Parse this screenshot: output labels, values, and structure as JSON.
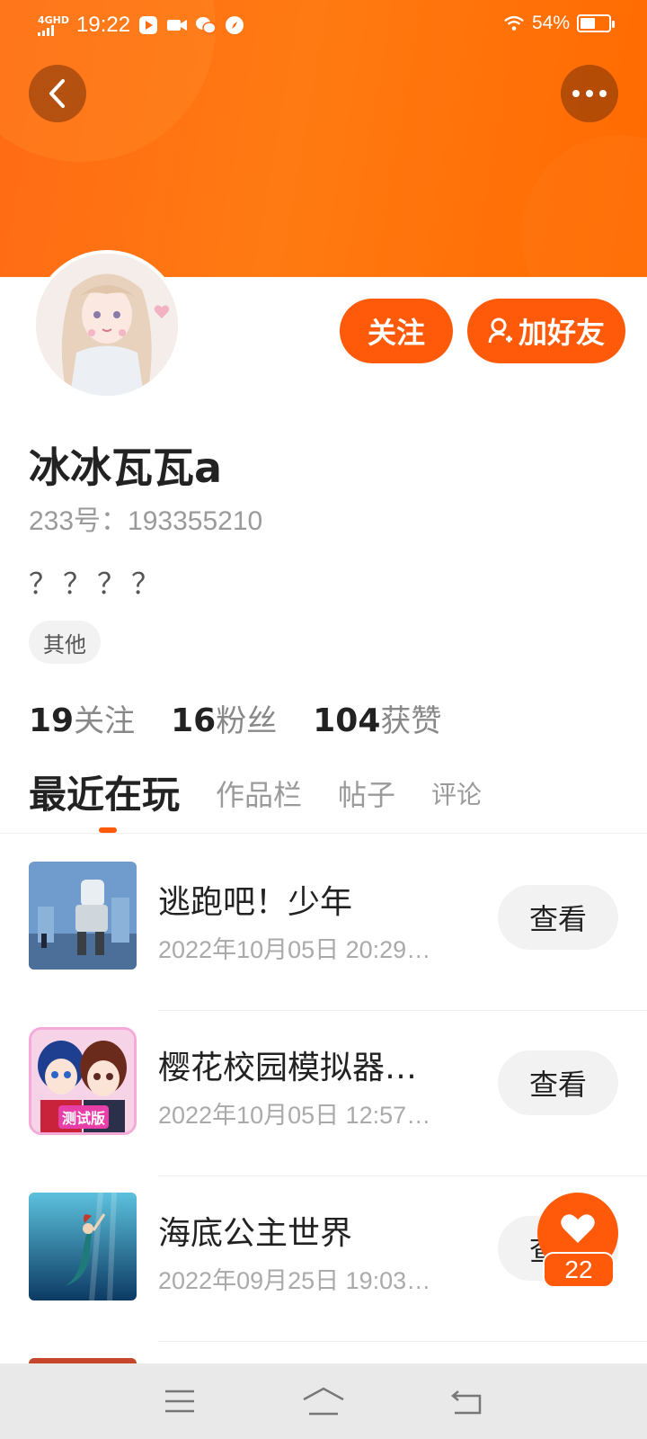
{
  "status_bar": {
    "network": "4GHD",
    "time": "19:22",
    "battery_percent": "54%",
    "battery_level": 0.54
  },
  "colors": {
    "accent": "#ff5a0a",
    "header_start": "#ff6a14",
    "header_end": "#ff6a00"
  },
  "profile": {
    "name": "冰冰瓦瓦a",
    "id_text": "233号：193355210",
    "bio": "？？？？",
    "tag": "其他",
    "follow_label": "关注",
    "add_friend_label": "加好友"
  },
  "stats": [
    {
      "num": "19",
      "label": "关注"
    },
    {
      "num": "16",
      "label": "粉丝"
    },
    {
      "num": "104",
      "label": "获赞"
    }
  ],
  "tabs": [
    "最近在玩",
    "作品栏",
    "帖子",
    "评论"
  ],
  "games": [
    {
      "title": "逃跑吧！少年",
      "time": "2022年10月05日 20:29…",
      "action": "查看"
    },
    {
      "title": "樱花校园模拟器…",
      "time": "2022年10月05日 12:57…",
      "action": "查看",
      "badge": "测试版"
    },
    {
      "title": "海底公主世界",
      "time": "2022年09月25日 19:03…",
      "action": "查看"
    }
  ],
  "like_count": "22"
}
